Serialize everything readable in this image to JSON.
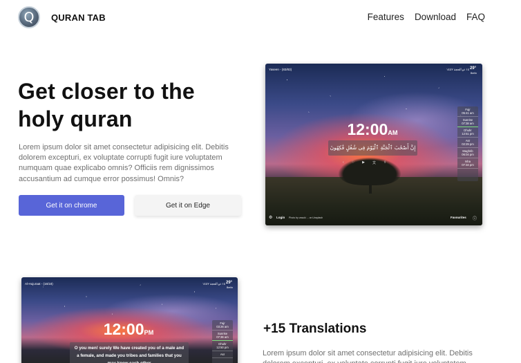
{
  "nav": {
    "logo_letter": "Q",
    "brand": "QURAN TAB",
    "links": [
      "Features",
      "Download",
      "FAQ"
    ]
  },
  "hero": {
    "title": "Get closer to the holy quran",
    "description": "Lorem ipsum dolor sit amet consectetur adipisicing elit. Debitis dolorem excepturi, ex voluptate corrupti fugit iure voluptatem numquam quae explicabo omnis? Officiis rem dignissimos accusantium ad cumque error possimus! Omnis?",
    "btn_chrome": "Get it on chrome",
    "btn_edge": "Get it on Edge"
  },
  "mockup1": {
    "surah": "Yaseen - (83/83)",
    "date": "١٤ ذو الحجة ١٤٤٢",
    "temp": "29°",
    "city": "Berlin",
    "time": "12:00",
    "ampm": "AM",
    "verse": "إِنَّ أَصْحَٰبَ ٱلْجَنَّةِ ٱلْيَوْمَ فِى شُغُلٍ فَٰكِهُونَ",
    "prayers": [
      {
        "name": "Fajr",
        "time": "05:41 am"
      },
      {
        "name": "Sunrise",
        "time": "07:38 am"
      },
      {
        "name": "Dhuhr",
        "time": "12:51 pm"
      },
      {
        "name": "Asr",
        "time": "02:29 pm"
      },
      {
        "name": "Maghrib",
        "time": "06:04 pm"
      },
      {
        "name": "Isha",
        "time": "07:34 pm"
      }
    ],
    "login": "Login",
    "credit": "Photo by vasuki ... on Unsplash",
    "favourites": "Favourites"
  },
  "mockup2": {
    "surah": "Al-Hujuraat - (16/18)",
    "date": "١٤ ذو الحجة ١٤٤٢",
    "temp": "29°",
    "city": "Berlin",
    "time": "12:00",
    "ampm": "PM",
    "verse": "O you men! surely We have created you of a male and a female, and made you tribes and families that you may know each other",
    "prayers": [
      {
        "name": "Fajr",
        "time": "03:26 am"
      },
      {
        "name": "Sunrise",
        "time": "07:36 am"
      },
      {
        "name": "Dhuhr",
        "time": "12:50 pm"
      },
      {
        "name": "Asr",
        "time": ""
      }
    ]
  },
  "features": {
    "title": "+15 Translations",
    "description": "Lorem ipsum dolor sit amet consectetur adipisicing elit. Debitis dolorem excepturi, ex voluptate corrupti fugit iure voluptatem"
  }
}
